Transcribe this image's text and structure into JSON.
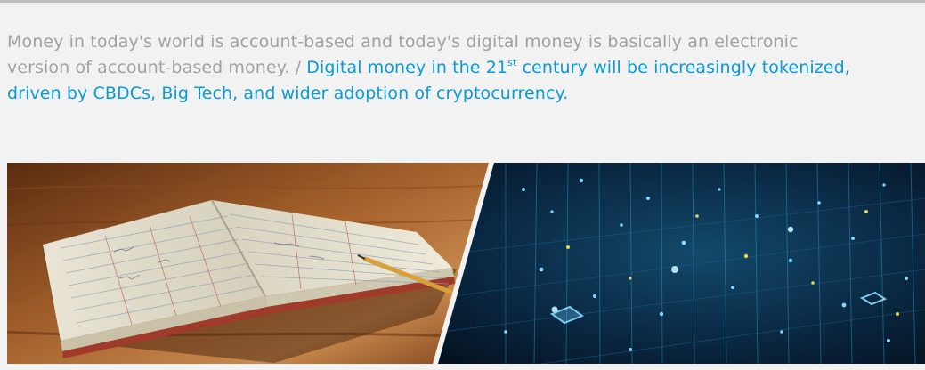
{
  "caption": {
    "part1": "Money in today's world is account-based and today's digital money is basically an electronic version of account-based money.",
    "separator": " / ",
    "part2_before_sup": "Digital money in the 21",
    "part2_sup": "st",
    "part2_after_sup": " century will be increasingly tokenized, driven by CBDCs, Big Tech, and wider adoption of cryptocurrency."
  },
  "images": {
    "left_icon": "ledger-book-photo",
    "right_icon": "digital-network-photo"
  },
  "colors": {
    "background": "#f2f2f2",
    "grey_text": "#a1a1a1",
    "blue_text": "#0a9ad6"
  }
}
